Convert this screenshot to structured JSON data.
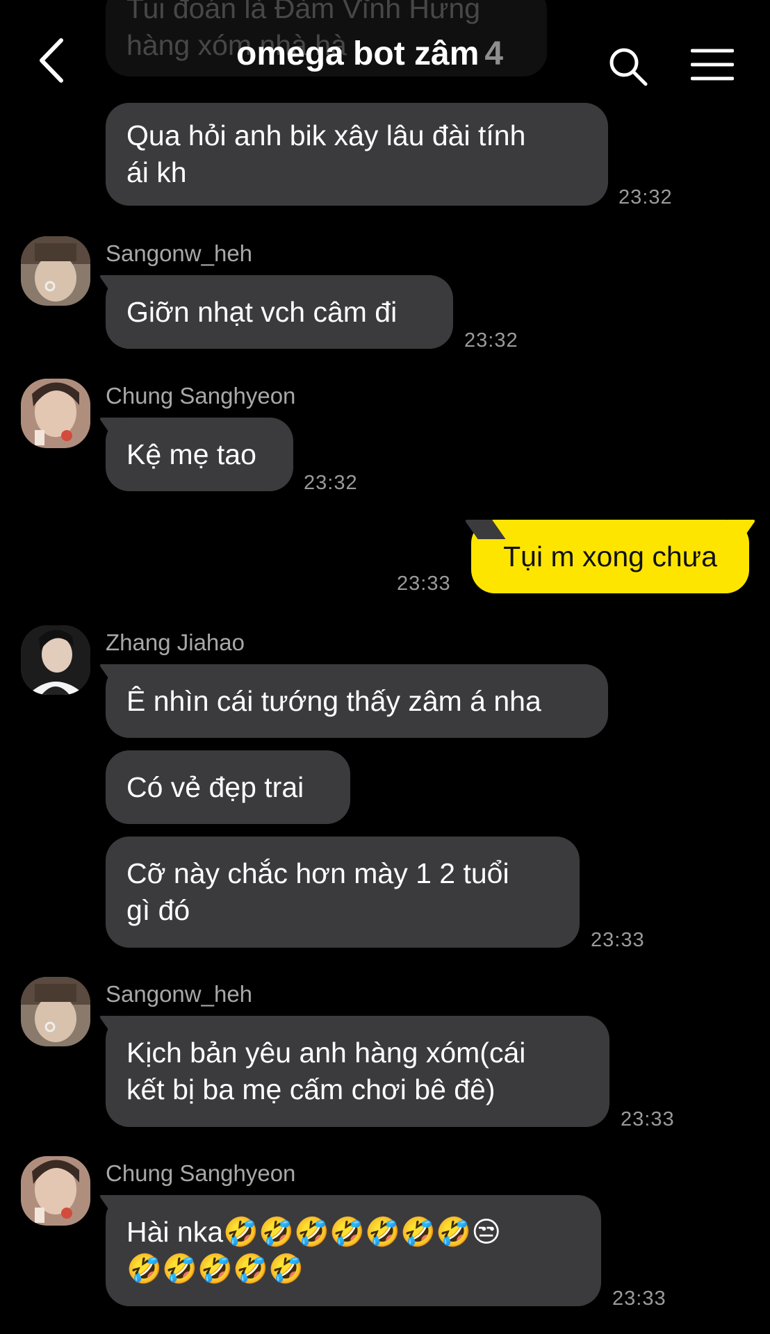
{
  "header": {
    "title": "omega bot zâm",
    "member_count": "4",
    "back_icon": "chevron-left-icon",
    "search_icon": "search-icon",
    "menu_icon": "hamburger-menu-icon"
  },
  "colors": {
    "background": "#000000",
    "incoming_bubble": "#3b3b3d",
    "outgoing_bubble": "#fee500",
    "timestamp": "#9b9b9b"
  },
  "messages": {
    "m0": {
      "text": "Tui đoán là Đàm Vĩnh Hưng\nhàng xóm nhà hà"
    },
    "m1": {
      "text": "Qua hỏi anh bik xây lâu đài tính\nái kh",
      "time": "23:32"
    },
    "m2": {
      "sender": "Sangonw_heh",
      "text": "Giỡn nhạt vch câm đi",
      "time": "23:32"
    },
    "m3": {
      "sender": "Chung Sanghyeon",
      "text": "Kệ mẹ tao",
      "time": "23:32"
    },
    "m4": {
      "text": "Tụi m xong chưa",
      "time": "23:33"
    },
    "m5": {
      "sender": "Zhang Jiahao",
      "text": "Ê nhìn cái tướng thấy zâm á nha"
    },
    "m6": {
      "text": "Có vẻ đẹp trai"
    },
    "m7": {
      "text": "Cỡ này chắc hơn mày 1 2 tuổi\ngì đó",
      "time": "23:33"
    },
    "m8": {
      "sender": "Sangonw_heh",
      "text": "Kịch bản yêu anh hàng xóm(cái\nkết bị ba mẹ cấm chơi bê đê)",
      "time": "23:33"
    },
    "m9": {
      "sender": "Chung Sanghyeon",
      "text": "Hài nka🤣🤣🤣🤣🤣🤣🤣😒\n🤣🤣🤣🤣🤣",
      "time": "23:33"
    }
  }
}
